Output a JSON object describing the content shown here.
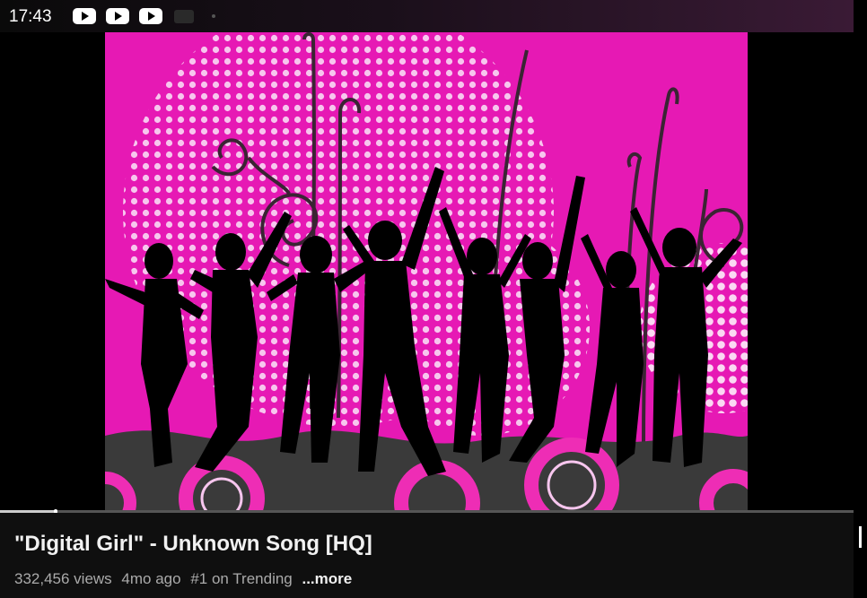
{
  "status_bar": {
    "time": "17:43",
    "notification_icons": [
      "youtube-icon",
      "youtube-icon",
      "youtube-icon",
      "media-icon",
      "dot-icon"
    ]
  },
  "video": {
    "progress_fraction": 0.065,
    "colors": {
      "background": "#e619b4",
      "dots": "#f7c6ee",
      "silhouette": "#000000",
      "floor": "#3a3a3a",
      "ring": "#ee2db5"
    }
  },
  "info": {
    "title": "\"Digital Girl\" - Unknown Song [HQ]",
    "views": "332,456 views",
    "age": "4mo ago",
    "trending": "#1 on Trending",
    "more": "...more"
  }
}
